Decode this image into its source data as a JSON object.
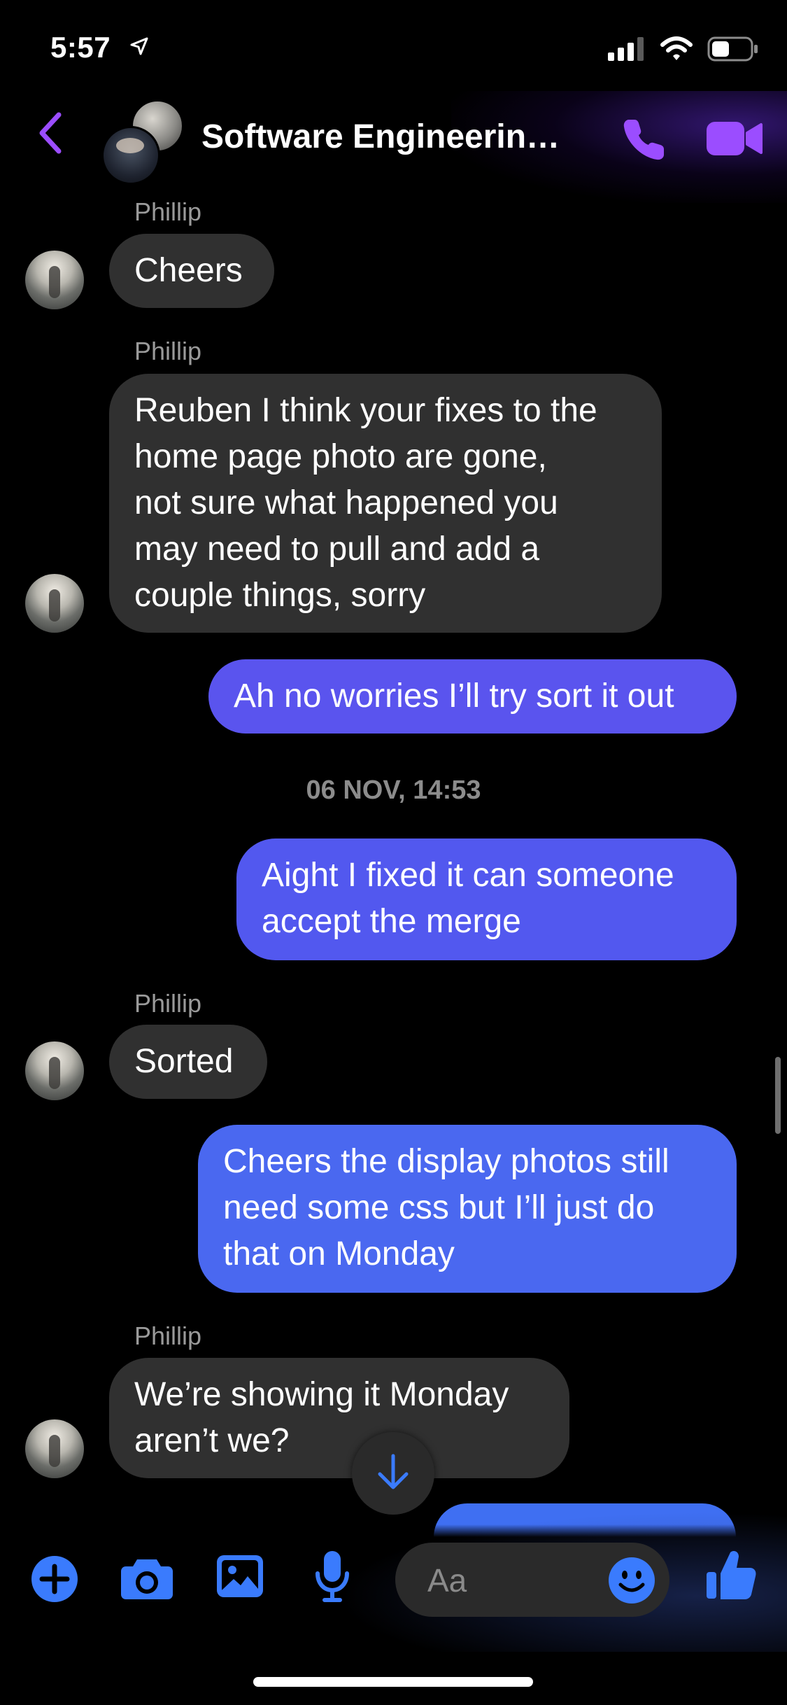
{
  "status_bar": {
    "time": "5:57"
  },
  "header": {
    "title": "Software Engineerin…",
    "accent_color": "#9b4dff"
  },
  "messages": [
    {
      "sender": "Phillip",
      "text": "Cheers",
      "direction": "in"
    },
    {
      "sender": "Phillip",
      "lines": [
        "Reuben I think your fixes to the",
        "home page photo are gone,",
        "not sure what happened you",
        "may need to pull and add a",
        "couple things, sorry"
      ],
      "direction": "in"
    },
    {
      "lines": [
        "Ah no worries I’ll try sort it out"
      ],
      "direction": "out"
    },
    {
      "timestamp": "06 NOV, 14:53"
    },
    {
      "lines": [
        "Aight I fixed it can someone",
        "accept the merge"
      ],
      "direction": "out"
    },
    {
      "sender": "Phillip",
      "text": "Sorted",
      "direction": "in"
    },
    {
      "lines": [
        "Cheers the display photos still",
        "need some css but I’ll just do",
        "that on Monday"
      ],
      "direction": "out"
    },
    {
      "sender": "Phillip",
      "lines": [
        "We’re showing it Monday",
        "aren’t we?"
      ],
      "direction": "in"
    }
  ],
  "composer": {
    "placeholder": "Aa",
    "icon_color": "#3a7bfd"
  }
}
